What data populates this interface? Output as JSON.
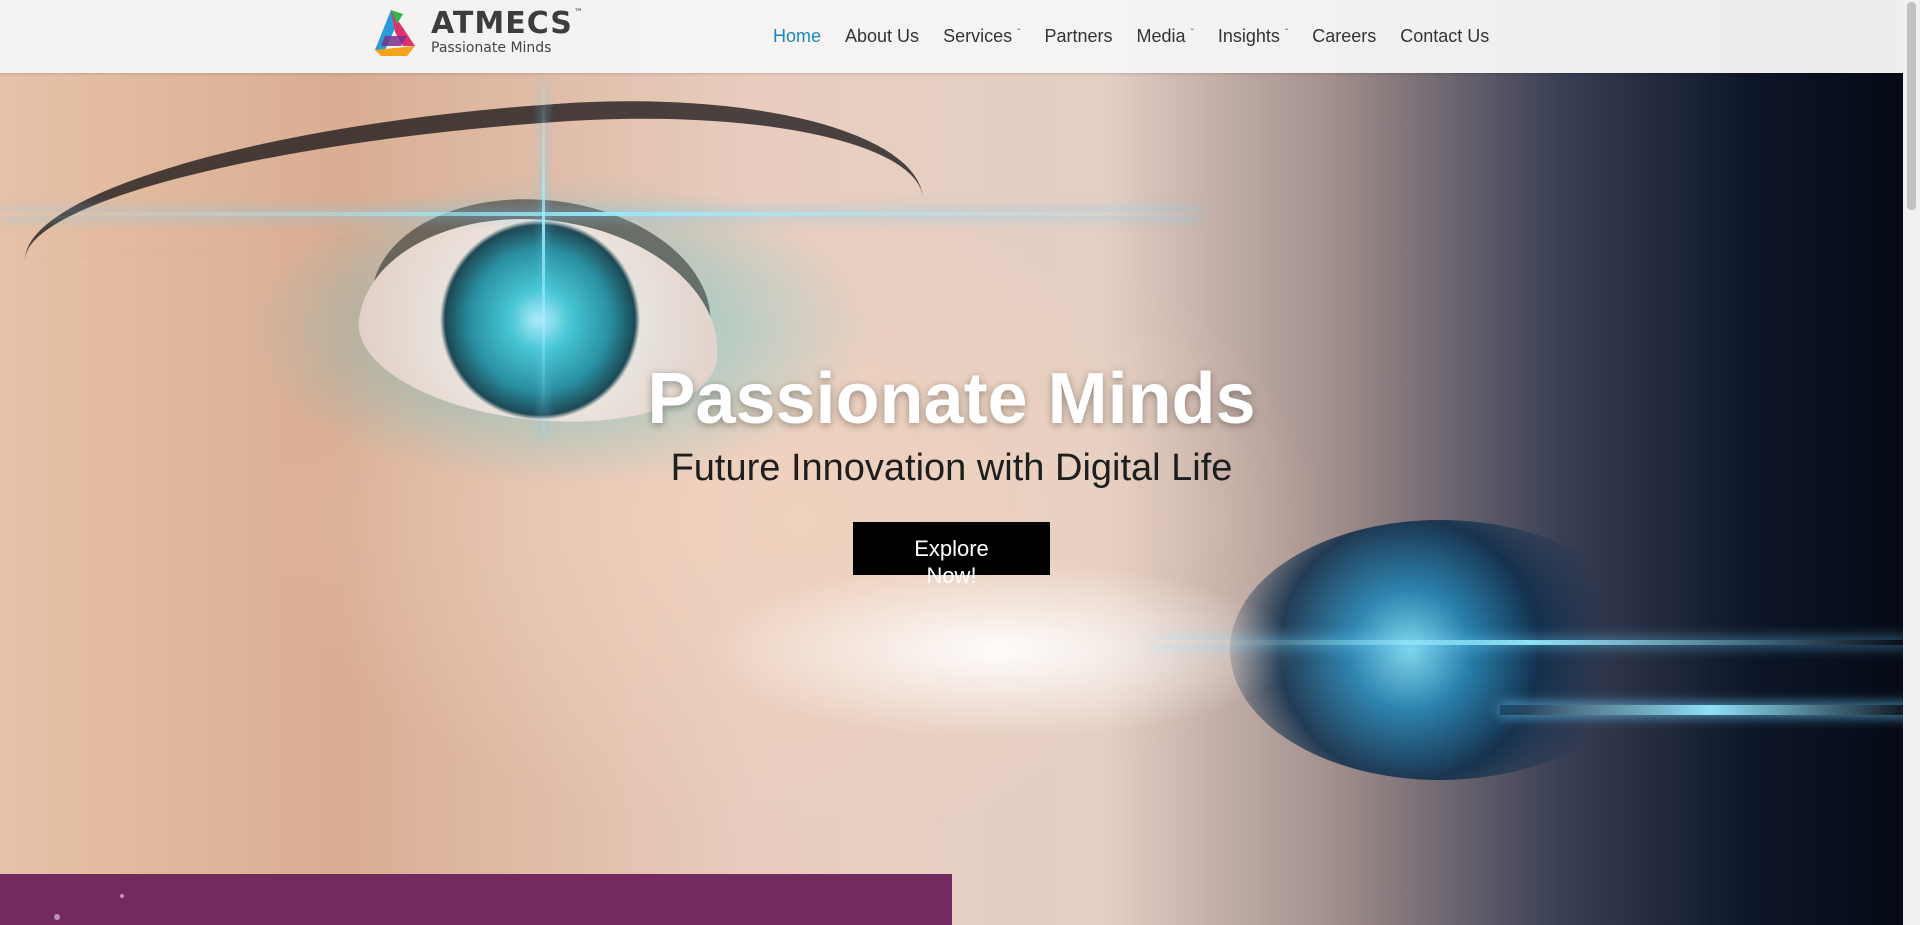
{
  "navbar": {
    "logo": {
      "name": "ATMECS",
      "trademark": "™",
      "tagline": "Passionate Minds"
    },
    "menu": [
      {
        "label": "Home",
        "active": true,
        "has_dropdown": false
      },
      {
        "label": "About Us",
        "active": false,
        "has_dropdown": false
      },
      {
        "label": "Services",
        "active": false,
        "has_dropdown": true
      },
      {
        "label": "Partners",
        "active": false,
        "has_dropdown": false
      },
      {
        "label": "Media",
        "active": false,
        "has_dropdown": true
      },
      {
        "label": "Insights",
        "active": false,
        "has_dropdown": true
      },
      {
        "label": "Careers",
        "active": false,
        "has_dropdown": false
      },
      {
        "label": "Contact Us",
        "active": false,
        "has_dropdown": false
      }
    ],
    "dropdown_glyph": "ˇ"
  },
  "hero": {
    "title": "Passionate Minds",
    "subtitle": "Future Innovation with Digital Life",
    "cta_label": "Explore Now!"
  },
  "colors": {
    "active_link": "#1a88b8",
    "cta_bg": "#000000",
    "purple_panel": "#732a5e",
    "navbar_bg": "#f5f5f5"
  },
  "icons": {
    "logo_mark": "atmecs-logo-icon",
    "dropdown": "chevron-down-icon"
  }
}
